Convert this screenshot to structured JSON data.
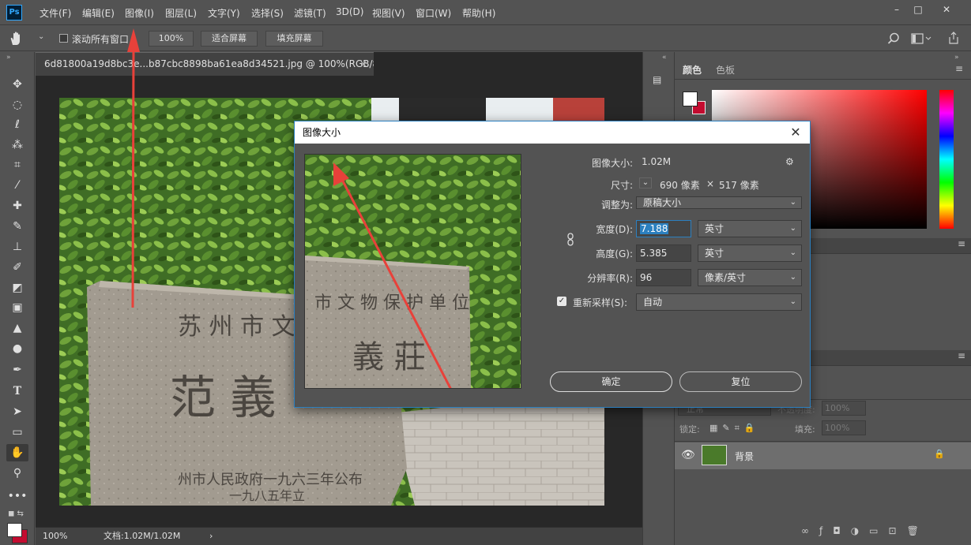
{
  "app": {
    "logo": "Ps",
    "menus": [
      "文件(F)",
      "编辑(E)",
      "图像(I)",
      "图层(L)",
      "文字(Y)",
      "选择(S)",
      "滤镜(T)",
      "3D(D)",
      "视图(V)",
      "窗口(W)",
      "帮助(H)"
    ],
    "window_controls": [
      "–",
      "□",
      "✕"
    ]
  },
  "options_bar": {
    "scroll_all_label": "滚动所有窗口",
    "zoom_value": "100%",
    "fit_screen_label": "适合屏幕",
    "fill_screen_label": "填充屏幕"
  },
  "document": {
    "tab_title": "6d81800a19d8bc3e...b87cbc8898ba61ea8d34521.jpg @ 100%(RGB/8#)",
    "tab_close": "×",
    "status_zoom": "100%",
    "status_doc": "文档:1.02M/1.02M",
    "status_arrow": "›"
  },
  "panels": {
    "color_tab": "颜色",
    "swatches_tab": "色板",
    "blend_mode": "正常",
    "opacity_label": "不透明度:",
    "opacity_value": "100%",
    "lock_label": "锁定:",
    "fill_label": "填充:",
    "fill_value": "100%",
    "layer_name": "背景"
  },
  "dialog": {
    "title": "图像大小",
    "image_size_label": "图像大小:",
    "image_size_value": "1.02M",
    "dimensions_label": "尺寸:",
    "dimensions_width": "690 像素",
    "dimensions_x": "×",
    "dimensions_height": "517 像素",
    "fit_to_label": "调整为:",
    "fit_to_value": "原稿大小",
    "width_label": "宽度(D):",
    "width_value": "7.188",
    "width_unit": "英寸",
    "height_label": "高度(G):",
    "height_value": "5.385",
    "height_unit": "英寸",
    "resolution_label": "分辨率(R):",
    "resolution_value": "96",
    "resolution_unit": "像素/英寸",
    "resample_label": "重新采样(S):",
    "resample_value": "自动",
    "ok_label": "确定",
    "reset_label": "复位"
  },
  "colors": {
    "accent": "#2c80c0",
    "annotation_arrow": "#e8413a"
  }
}
